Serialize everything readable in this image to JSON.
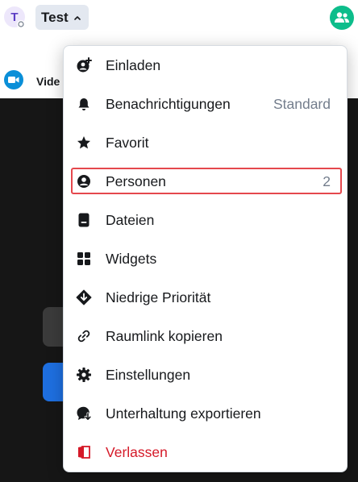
{
  "header": {
    "room_avatar_letter": "T",
    "room_title": "Test"
  },
  "subbar": {
    "video_label": "Vide"
  },
  "menu": {
    "items": [
      {
        "label": "Einladen",
        "value": "",
        "icon": "invite-icon"
      },
      {
        "label": "Benachrichtigungen",
        "value": "Standard",
        "icon": "bell-icon"
      },
      {
        "label": "Favorit",
        "value": "",
        "icon": "star-icon"
      },
      {
        "label": "Personen",
        "value": "2",
        "icon": "person-icon"
      },
      {
        "label": "Dateien",
        "value": "",
        "icon": "file-icon"
      },
      {
        "label": "Widgets",
        "value": "",
        "icon": "grid-icon"
      },
      {
        "label": "Niedrige Priorität",
        "value": "",
        "icon": "low-priority-icon"
      },
      {
        "label": "Raumlink kopieren",
        "value": "",
        "icon": "link-icon"
      },
      {
        "label": "Einstellungen",
        "value": "",
        "icon": "gear-icon"
      },
      {
        "label": "Unterhaltung exportieren",
        "value": "",
        "icon": "export-icon"
      },
      {
        "label": "Verlassen",
        "value": "",
        "icon": "leave-icon"
      }
    ]
  },
  "colors": {
    "accent_green": "#0dbd8b",
    "danger_red": "#d51928",
    "highlight_red": "#e5484d"
  }
}
